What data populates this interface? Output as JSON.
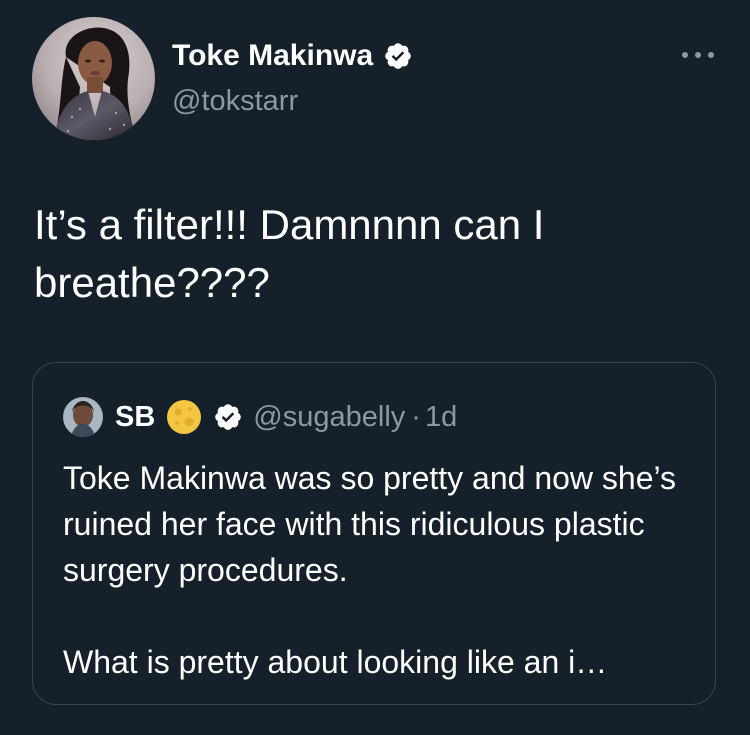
{
  "author": {
    "name": "Toke Makinwa",
    "handle": "@tokstarr",
    "verified": true,
    "avatar_icon": "profile-photo-avatar"
  },
  "menu": {
    "icon": "more-horizontal-icon",
    "glyph": "•••"
  },
  "tweet": {
    "text": "It’s a filter!!! Damnnnn can I breathe????"
  },
  "quoted_tweet": {
    "author_name": "SB",
    "name_emoji": "full-moon-emoji",
    "verified": true,
    "handle": "@sugabelly",
    "separator": "·",
    "time": "1d",
    "paragraphs": [
      "Toke Makinwa was so pretty and now she’s ruined her face with this ridiculous plastic surgery procedures.",
      "What is pretty about looking like an i…"
    ]
  },
  "colors": {
    "background": "#15202b",
    "text_primary": "#ffffff",
    "text_secondary": "#8b98a5",
    "card_border": "#38444d",
    "verified_badge": "#ffffff",
    "moon": "#f4c542"
  }
}
